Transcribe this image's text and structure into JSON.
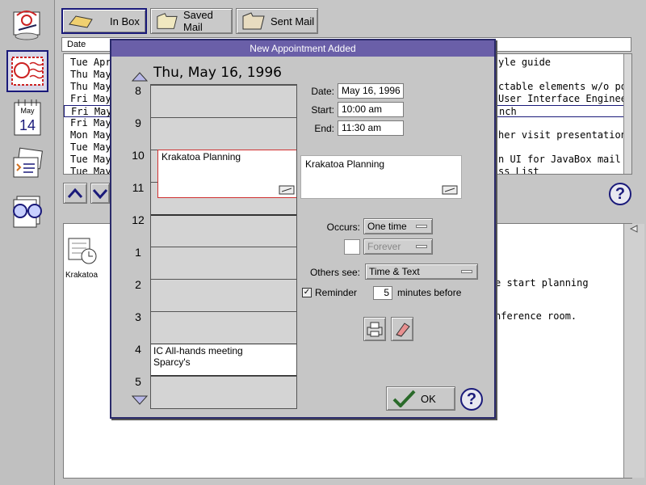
{
  "toolbar": {
    "inbox_label": "In Box",
    "saved_label": "Saved Mail",
    "sent_label": "Sent Mail"
  },
  "sidebar": {
    "calendar_month": "May",
    "calendar_day": "14"
  },
  "mail_list": {
    "column_header": "Date",
    "rows": [
      {
        "date": "Tue Apr",
        "subject": "yle guide"
      },
      {
        "date": "Thu May",
        "subject": ""
      },
      {
        "date": "Thu May",
        "subject": "ctable elements w/o poi"
      },
      {
        "date": "Fri May",
        "subject": "User Interface Engineerin"
      },
      {
        "date": "Fri May",
        "subject": "nch"
      },
      {
        "date": "Fri May",
        "subject": ""
      },
      {
        "date": "Mon May",
        "subject": "her visit presentation"
      },
      {
        "date": "Tue May",
        "subject": ""
      },
      {
        "date": "Tue May",
        "subject": "n UI for JavaBox mail"
      },
      {
        "date": "Tue May",
        "subject": "ss List"
      }
    ]
  },
  "preview": {
    "attachment_label": "Krakatoa",
    "line1": "e start planning",
    "line2": "nference room."
  },
  "dialog": {
    "title": "New Appointment Added",
    "date_heading": "Thu, May 16, 1996",
    "hours": [
      "8",
      "9",
      "10",
      "11",
      "12",
      "1",
      "2",
      "3",
      "4",
      "5"
    ],
    "appointments": [
      {
        "text": "Krakatoa Planning"
      },
      {
        "text": "IC All-hands meeting\nSparcy's"
      }
    ],
    "date_label": "Date:",
    "date_value": "May 16, 1996",
    "start_label": "Start:",
    "start_value": "10:00 am",
    "end_label": "End:",
    "end_value": "11:30 am",
    "description": "Krakatoa Planning",
    "occurs_label": "Occurs:",
    "occurs_value": "One time",
    "forever_value": "Forever",
    "others_label": "Others see:",
    "others_value": "Time & Text",
    "reminder_label": "Reminder",
    "reminder_minutes": "5",
    "minutes_label": "minutes before",
    "ok_label": "OK"
  },
  "colors": {
    "title_bar": "#6a5fa8",
    "accent": "#1a1a7a",
    "selected_appt_border": "#d03030"
  }
}
